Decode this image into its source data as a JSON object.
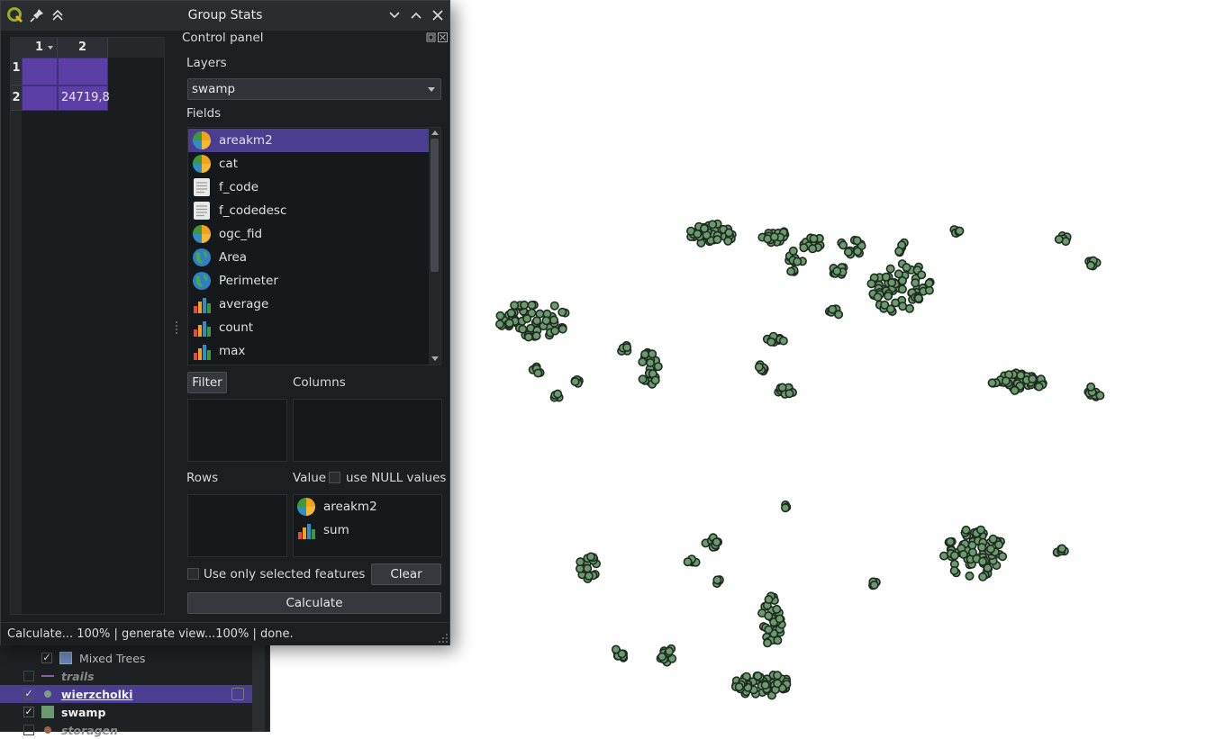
{
  "dialog": {
    "title": "Group Stats",
    "control_panel_title": "Control panel"
  },
  "table": {
    "column_headers": [
      "1",
      "2"
    ],
    "row_headers": [
      "1",
      "2"
    ],
    "cells": [
      [
        "",
        ""
      ],
      [
        "",
        "24719,8"
      ]
    ]
  },
  "control": {
    "layers_label": "Layers",
    "layers_selected": "swamp",
    "fields_label": "Fields",
    "fields": [
      {
        "label": "areakm2",
        "icon": "numeric-field-icon",
        "selected": true
      },
      {
        "label": "cat",
        "icon": "numeric-field-icon"
      },
      {
        "label": "f_code",
        "icon": "text-field-icon"
      },
      {
        "label": "f_codedesc",
        "icon": "text-field-icon"
      },
      {
        "label": "ogc_fid",
        "icon": "numeric-field-icon"
      },
      {
        "label": "Area",
        "icon": "geometry-globe-icon"
      },
      {
        "label": "Perimeter",
        "icon": "geometry-globe-icon"
      },
      {
        "label": "average",
        "icon": "statistic-bars-icon"
      },
      {
        "label": "count",
        "icon": "statistic-bars-icon"
      },
      {
        "label": "max",
        "icon": "statistic-bars-icon"
      }
    ],
    "filter_button": "Filter",
    "columns_label": "Columns",
    "rows_label": "Rows",
    "value_label": "Value",
    "use_null_label": "use NULL values",
    "value_items": [
      {
        "label": "areakm2",
        "icon": "numeric-field-icon"
      },
      {
        "label": "sum",
        "icon": "statistic-bars-icon"
      }
    ],
    "use_selected_label": "Use only selected features",
    "clear_button": "Clear",
    "calculate_button": "Calculate"
  },
  "status": {
    "text": "Calculate... 100% |  generate view...100% |  done."
  },
  "layers_panel": {
    "items": [
      {
        "label": "Mixed Trees",
        "checked": true,
        "style": "normal"
      },
      {
        "label": "trails",
        "checked": false,
        "style": "italic"
      },
      {
        "label": "wierzcholki",
        "checked": true,
        "style": "bold-underline"
      },
      {
        "label": "swamp",
        "checked": true,
        "style": "bold"
      },
      {
        "label": "storagen",
        "checked": false,
        "style": "italic"
      }
    ]
  },
  "colors": {
    "accent_selection": "#4b3d8f",
    "table_cell": "#5c3fa6",
    "map_marker_fill": "#6a9a6e",
    "map_marker_stroke": "#1f2a20"
  }
}
